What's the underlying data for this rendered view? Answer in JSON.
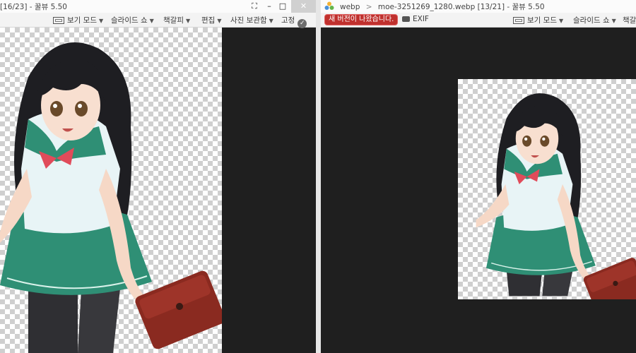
{
  "left_window": {
    "title": "[16/23] - 꿀뷰 5.50",
    "toolbar": {
      "view_mode": "보기 모드",
      "slideshow": "슬라이드 쇼",
      "bookmark": "책갈피",
      "edit": "편집",
      "photo_storage": "사진 보관함",
      "pin": "고정"
    },
    "window_buttons": {
      "fullscreen": "⛶",
      "minimize": "–",
      "maximize": "□",
      "close": "✕"
    }
  },
  "right_window": {
    "breadcrumb": {
      "folder": "webp",
      "separator": ">",
      "file": "moe-3251269_1280.webp",
      "index": "[13/21]",
      "app": "- 꿀뷰 5.50"
    },
    "new_version_badge": "새 버전이 나왔습니다.",
    "exif_label": "EXIF",
    "toolbar": {
      "view_mode": "보기 모드",
      "slideshow": "슬라이드 쇼",
      "bookmark": "책갈"
    }
  },
  "colors": {
    "viewer_bg": "#1f1f1f",
    "badge": "#c0312e",
    "skirt": "#2f8f75",
    "bag": "#8a2a20"
  }
}
